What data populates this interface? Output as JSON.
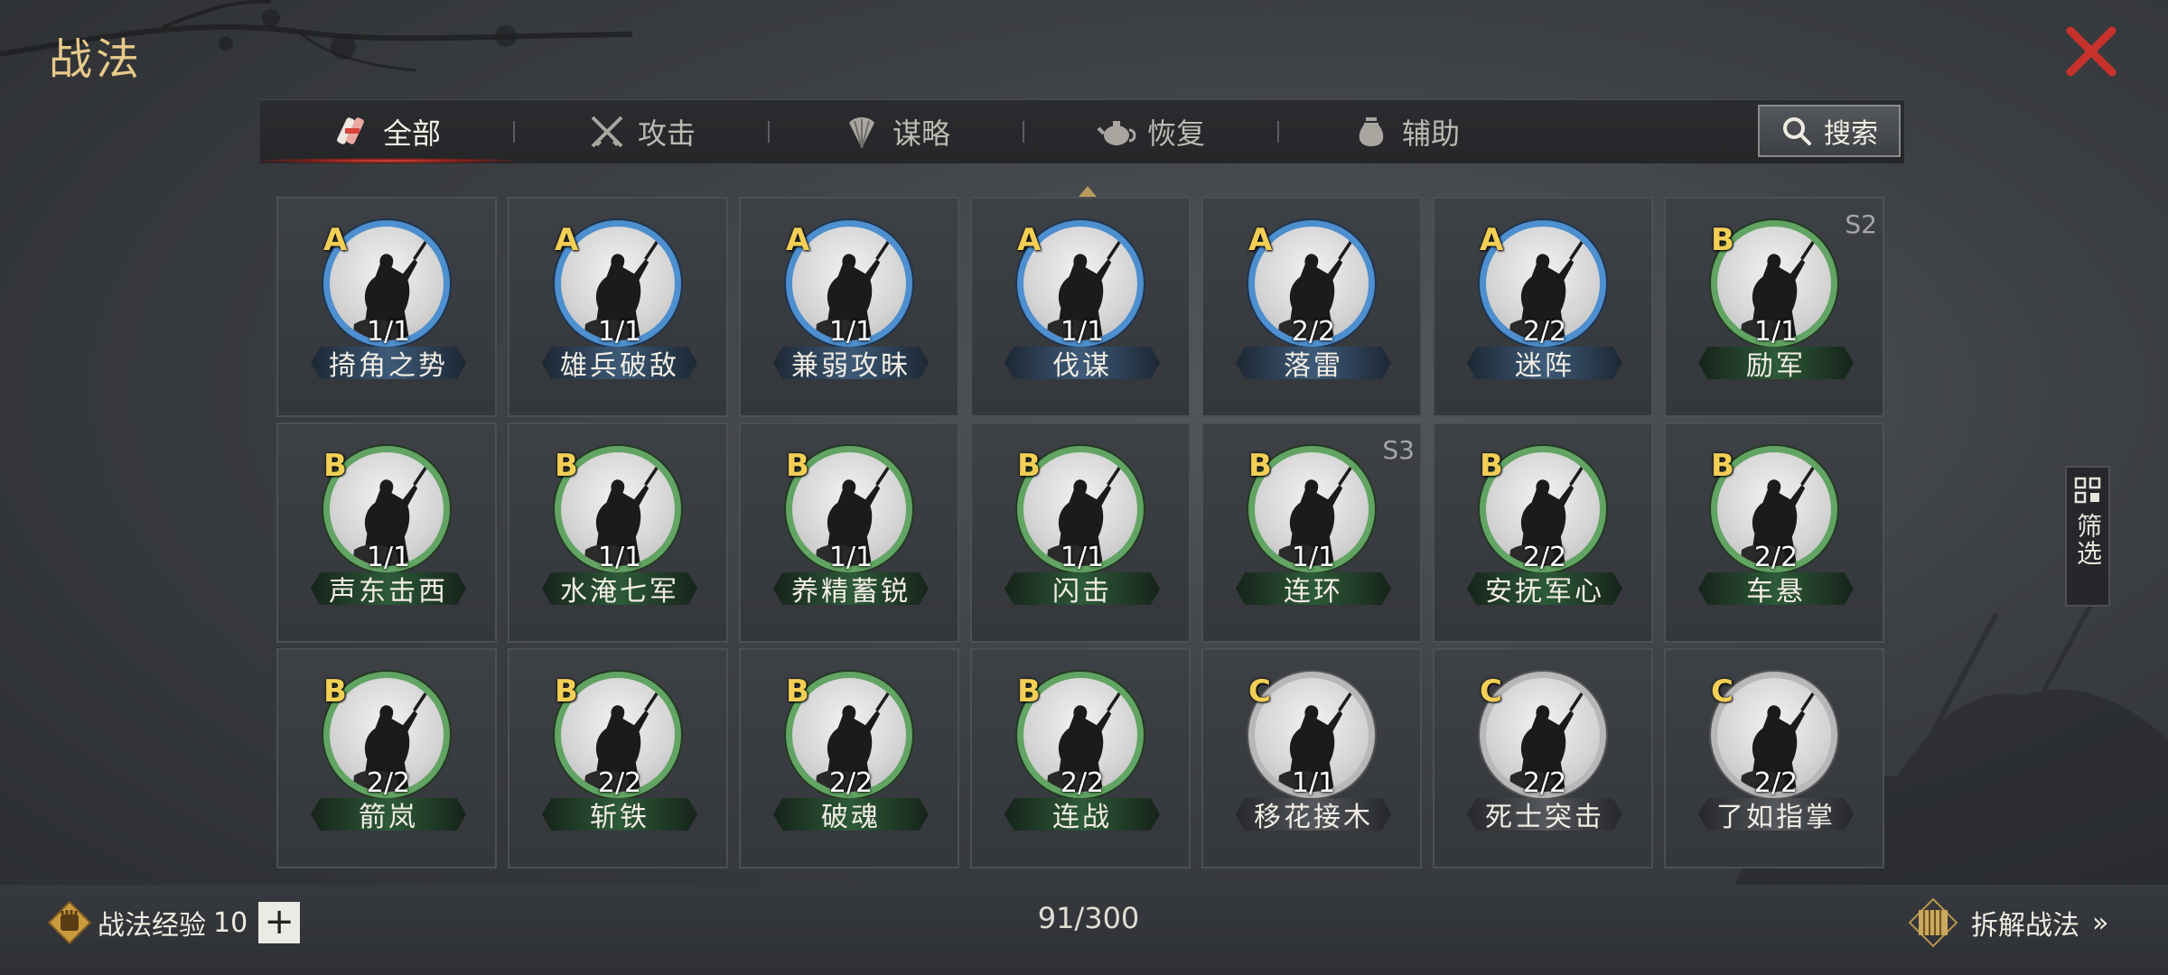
{
  "title": "战法",
  "tabs": [
    {
      "label": "全部",
      "icon": "scroll-bundle-icon",
      "active": true
    },
    {
      "label": "攻击",
      "icon": "crossed-swords-icon",
      "active": false
    },
    {
      "label": "谋略",
      "icon": "feather-fan-icon",
      "active": false
    },
    {
      "label": "恢复",
      "icon": "teapot-icon",
      "active": false
    },
    {
      "label": "辅助",
      "icon": "pouch-icon",
      "active": false
    }
  ],
  "search": {
    "label": "搜索"
  },
  "filter": {
    "label": "筛选"
  },
  "tactics": [
    {
      "grade": "A",
      "level": "1/1",
      "name": "掎角之势",
      "color": "blue",
      "season": ""
    },
    {
      "grade": "A",
      "level": "1/1",
      "name": "雄兵破敌",
      "color": "blue",
      "season": ""
    },
    {
      "grade": "A",
      "level": "1/1",
      "name": "兼弱攻昧",
      "color": "blue",
      "season": ""
    },
    {
      "grade": "A",
      "level": "1/1",
      "name": "伐谋",
      "color": "blue",
      "season": ""
    },
    {
      "grade": "A",
      "level": "2/2",
      "name": "落雷",
      "color": "blue",
      "season": ""
    },
    {
      "grade": "A",
      "level": "2/2",
      "name": "迷阵",
      "color": "blue",
      "season": ""
    },
    {
      "grade": "B",
      "level": "1/1",
      "name": "励军",
      "color": "green",
      "season": "S2"
    },
    {
      "grade": "B",
      "level": "1/1",
      "name": "声东击西",
      "color": "green",
      "season": ""
    },
    {
      "grade": "B",
      "level": "1/1",
      "name": "水淹七军",
      "color": "green",
      "season": ""
    },
    {
      "grade": "B",
      "level": "1/1",
      "name": "养精蓄锐",
      "color": "green",
      "season": ""
    },
    {
      "grade": "B",
      "level": "1/1",
      "name": "闪击",
      "color": "green",
      "season": ""
    },
    {
      "grade": "B",
      "level": "1/1",
      "name": "连环",
      "color": "green",
      "season": "S3"
    },
    {
      "grade": "B",
      "level": "2/2",
      "name": "安抚军心",
      "color": "green",
      "season": ""
    },
    {
      "grade": "B",
      "level": "2/2",
      "name": "车悬",
      "color": "green",
      "season": ""
    },
    {
      "grade": "B",
      "level": "2/2",
      "name": "箭岚",
      "color": "green",
      "season": ""
    },
    {
      "grade": "B",
      "level": "2/2",
      "name": "斩铁",
      "color": "green",
      "season": ""
    },
    {
      "grade": "B",
      "level": "2/2",
      "name": "破魂",
      "color": "green",
      "season": ""
    },
    {
      "grade": "B",
      "level": "2/2",
      "name": "连战",
      "color": "green",
      "season": ""
    },
    {
      "grade": "C",
      "level": "1/1",
      "name": "移花接木",
      "color": "grey",
      "season": ""
    },
    {
      "grade": "C",
      "level": "2/2",
      "name": "死士突击",
      "color": "grey",
      "season": ""
    },
    {
      "grade": "C",
      "level": "2/2",
      "name": "了如指掌",
      "color": "grey",
      "season": ""
    }
  ],
  "footer": {
    "exp_label": "战法经验",
    "exp_value": "10",
    "plus": "+",
    "capacity": "91/300",
    "dismantle_label": "拆解战法",
    "dismantle_arrow": "»"
  },
  "colors": {
    "title_gold": "#e7c98a",
    "grade_yellow": "#f3cf55",
    "ring_blue": "#4d8fcf",
    "ring_green": "#62a463",
    "ring_grey": "#b7b7b7",
    "close_red": "#c8322c",
    "tab_underline": "#e2463a"
  }
}
